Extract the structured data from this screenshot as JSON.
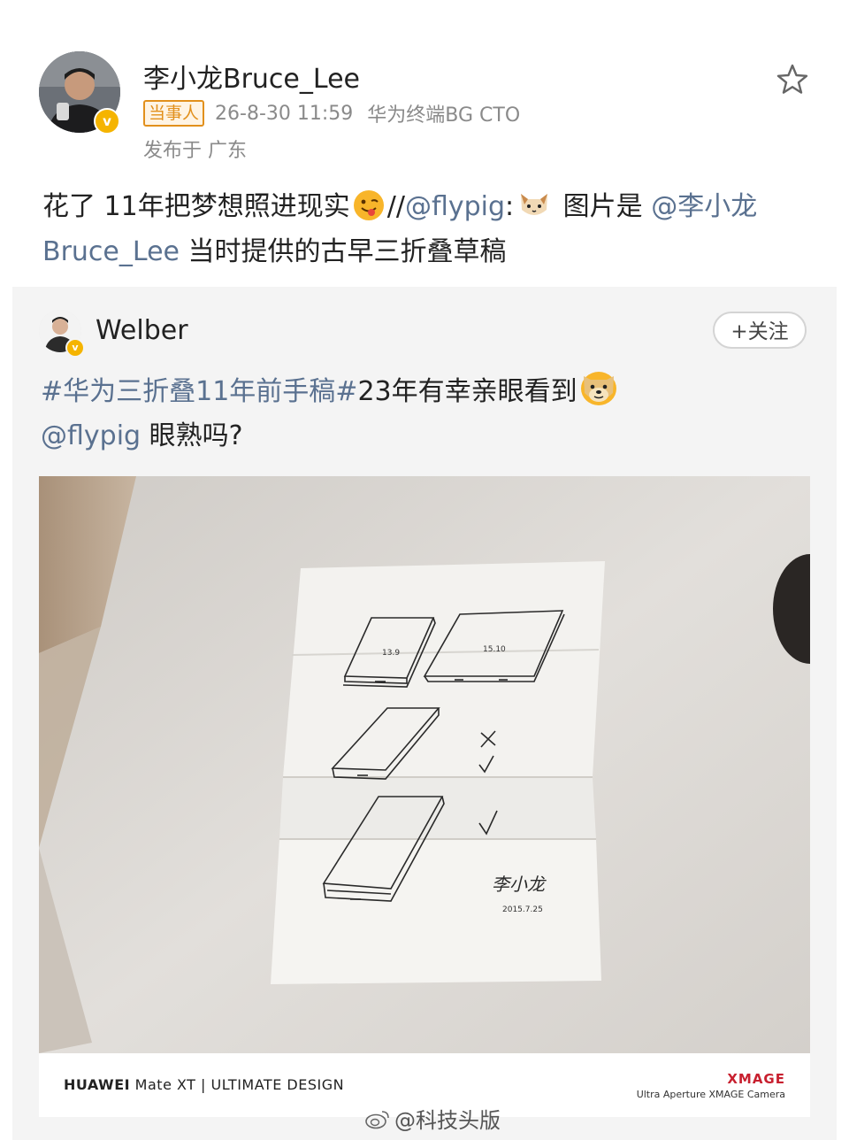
{
  "post": {
    "username": "李小龙Bruce_Lee",
    "tag": "当事人",
    "time": "26-8-30 11:59",
    "title": "华为终端BG CTO",
    "location": "发布于 广东",
    "text_part1": "花了 11年把梦想照进现实",
    "text_part2": "//",
    "mention_flypig": "@flypig",
    "text_colon": ":",
    "text_part3": " 图片是 ",
    "mention_lee_line1": "@李小龙",
    "mention_lee_line2": "Bruce_Lee",
    "text_part4": " 当时提供的古早三折叠草稿"
  },
  "repost": {
    "username": "Welber",
    "follow_label": "+关注",
    "hashtag1": "#华为三折叠11年前手稿#",
    "text1": "23年有幸亲眼看到",
    "mention": "@flypig",
    "text2": " 眼熟吗?",
    "photo_caption": {
      "brand": "HUAWEI",
      "model": " Mate XT | ULTIMATE DESIGN",
      "xmage": "XMAGE",
      "camera": "Ultra Aperture XMAGE Camera"
    },
    "sketch": {
      "label1": "13.9",
      "label2": "15.10",
      "signature": "李小龙",
      "date": "2015.7.25"
    }
  },
  "watermark": "@科技头版",
  "colors": {
    "link": "#5a7190",
    "tag": "#e2901c",
    "badge": "#f5b400",
    "xmage": "#c8202f"
  }
}
